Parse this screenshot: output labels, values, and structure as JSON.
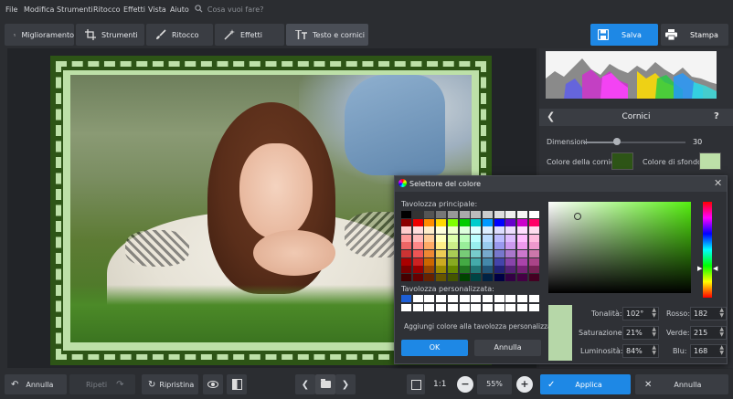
{
  "menu": [
    "File",
    "Modifica",
    "Strumenti",
    "Ritocco",
    "Effetti",
    "Vista",
    "Aiuto"
  ],
  "search": {
    "placeholder": "Cosa vuoi fare?"
  },
  "tabs": [
    {
      "label": "Miglioramento",
      "icon": "sliders-icon"
    },
    {
      "label": "Strumenti",
      "icon": "crop-icon"
    },
    {
      "label": "Ritocco",
      "icon": "brush-icon"
    },
    {
      "label": "Effetti",
      "icon": "magic-wand-icon"
    },
    {
      "label": "Testo e cornici",
      "icon": "text-icon",
      "active": true
    }
  ],
  "save_label": "Salva",
  "print_label": "Stampa",
  "panel": {
    "title": "Cornici",
    "help": "?",
    "dimension_label": "Dimensioni",
    "dimension_value": "30",
    "dimension_fraction": 0.36,
    "frame_color_label": "Colore della cornice:",
    "frame_color": "#2d5416",
    "bg_color_label": "Colore di sfondo:",
    "bg_color": "#bde0a8"
  },
  "dialog": {
    "title": "Selettore del colore",
    "main_palette_label": "Tavolozza principale:",
    "custom_palette_label": "Tavolozza personalizzata:",
    "add_custom_label": "Aggiungi colore alla tavolozza personalizzata",
    "ok_label": "OK",
    "cancel_label": "Annulla",
    "hue_label": "Tonalità:",
    "hue_value": "102°",
    "sat_label": "Saturazione:",
    "sat_value": "21%",
    "lum_label": "Luminosità:",
    "lum_value": "84%",
    "red_label": "Rosso:",
    "red_value": "182",
    "green_label": "Verde:",
    "green_value": "215",
    "blue_label": "Blu:",
    "blue_value": "168",
    "current_color": "#b6d7a8"
  },
  "bottom": {
    "undo_label": "Annulla",
    "redo_label": "Ripeti",
    "reset_label": "Ripristina",
    "zoom_1to1": "1:1",
    "zoom_value": "55%",
    "apply_label": "Applica",
    "cancel_label": "Annulla"
  },
  "colors": {
    "accent": "#1e88e5",
    "frame": "#2d5416",
    "frame_light": "#bde0a8"
  }
}
